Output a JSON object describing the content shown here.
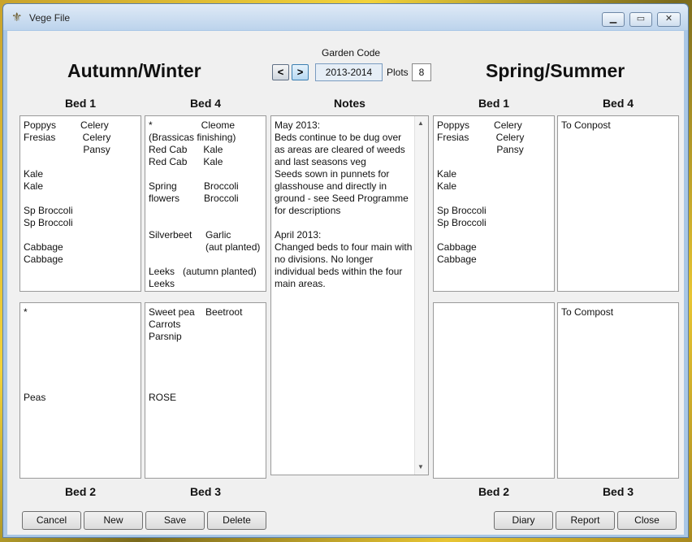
{
  "window": {
    "title": "Vege File",
    "icon": "fleur-de-lis-icon"
  },
  "header": {
    "autumn_winter": "Autumn/Winter",
    "spring_summer": "Spring/Summer",
    "garden_code_label": "Garden Code",
    "prev_label": "<",
    "next_label": ">",
    "garden_code": "2013-2014",
    "plots_label": "Plots",
    "plots_value": "8"
  },
  "labels": {
    "bed1": "Bed 1",
    "bed2": "Bed 2",
    "bed3": "Bed 3",
    "bed4": "Bed 4",
    "notes": "Notes"
  },
  "beds": {
    "aw_bed1": "Poppys         Celery\nFresias          Celery\n                      Pansy\n\nKale\nKale\n\nSp Broccoli\nSp Broccoli\n\nCabbage\nCabbage",
    "aw_bed4": "*                  Cleome\n(Brassicas finishing)\nRed Cab      Kale\nRed Cab      Kale\n\nSpring          Broccoli\nflowers         Broccoli\n\n\nSilverbeet     Garlic\n                     (aut planted)\n\nLeeks   (autumn planted)\nLeeks",
    "aw_bed2": "*\n\n\n\n\n\n\nPeas",
    "aw_bed3": "Sweet pea    Beetroot\nCarrots\nParsnip\n\n\n\n\nROSE",
    "ss_bed1": "Poppys         Celery\nFresias          Celery\n                      Pansy\n\nKale\nKale\n\nSp Broccoli\nSp Broccoli\n\nCabbage\nCabbage",
    "ss_bed4": "To Conpost",
    "ss_bed2": "",
    "ss_bed3": "To Compost"
  },
  "notes": "May 2013:\nBeds continue to be dug over as areas are cleared of weeds and last seasons veg\nSeeds sown in punnets for glasshouse and directly in ground - see Seed Programme for descriptions\n\nApril 2013:\nChanged beds to four main with no divisions. No longer individual beds within the four main areas.",
  "buttons": {
    "cancel": "Cancel",
    "new": "New",
    "save": "Save",
    "delete": "Delete",
    "diary": "Diary",
    "report": "Report",
    "close": "Close"
  }
}
